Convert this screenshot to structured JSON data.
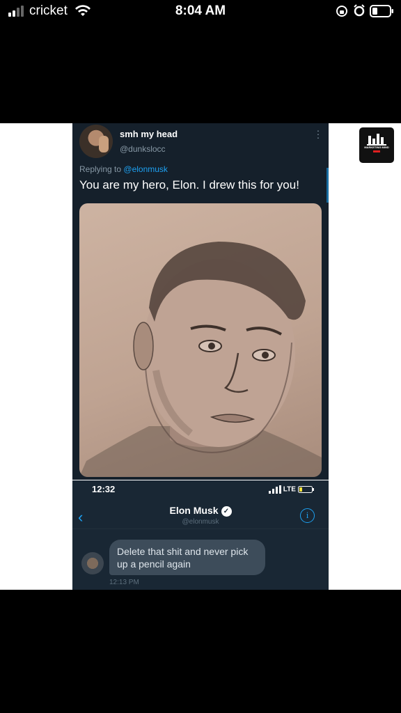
{
  "status_bar": {
    "carrier": "cricket",
    "time": "8:04 AM"
  },
  "tweet": {
    "display_name": "smh my head",
    "handle": "@dunkslocc",
    "replying_prefix": "Replying to",
    "replying_to": "@elonmusk",
    "text": "You are my hero, Elon. I drew this for you!"
  },
  "dm": {
    "status_time": "12:32",
    "network": "LTE",
    "contact_name": "Elon Musk",
    "contact_handle": "@elonmusk",
    "message": "Delete that shit and never pick up a pencil again",
    "message_time": "12:13 PM"
  },
  "badge": {
    "text": "MARKETING MIND"
  },
  "colors": {
    "twitter_dark": "#15202b",
    "twitter_blue": "#1da1f2",
    "dm_bubble": "#3d4c5a"
  }
}
